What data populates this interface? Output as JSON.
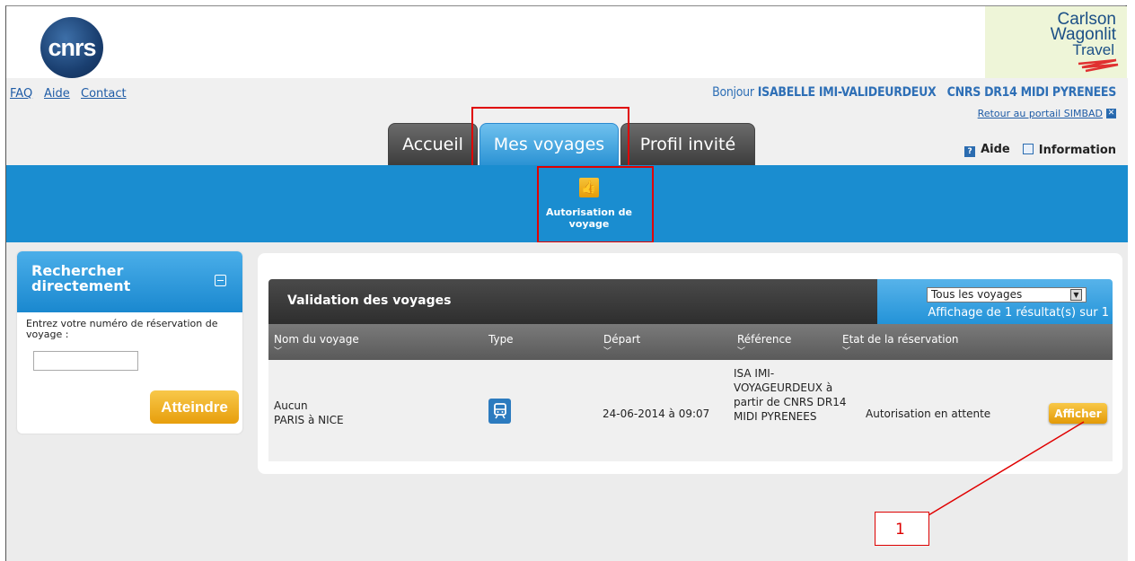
{
  "header": {
    "cnrs_logo": "cnrs",
    "partner_logo": [
      "Carlson",
      "Wagonlit",
      "Travel"
    ],
    "links": [
      "FAQ",
      "Aide",
      "Contact"
    ],
    "greeting_prefix": "Bonjour",
    "user_name": "ISABELLE IMI-VALIDEURDEUX",
    "organization": "CNRS DR14 MIDI PYRENEES",
    "return_link": "Retour au portail SIMBAD",
    "help_label": "Aide",
    "info_label": "Information"
  },
  "tabs": [
    {
      "label": "Accueil",
      "active": false
    },
    {
      "label": "Mes voyages",
      "active": true
    },
    {
      "label": "Profil invité",
      "active": false
    }
  ],
  "subnav": {
    "label": "Autorisation de voyage",
    "icon": "thumbs-up-icon"
  },
  "sidebar": {
    "title_line1": "Rechercher",
    "title_line2": "directement",
    "prompt": "Entrez votre numéro de réservation de voyage :",
    "input_value": "",
    "button_label": "Atteindre"
  },
  "validation": {
    "title": "Validation des voyages",
    "filter_selected": "Tous les voyages",
    "result_count": "Affichage de 1 résultat(s) sur 1",
    "columns": [
      "Nom du voyage",
      "Type",
      "Départ",
      "Référence",
      "Etat de la réservation"
    ],
    "rows": [
      {
        "name_line1": "Aucun",
        "name_line2": "PARIS à NICE",
        "type": "train-icon",
        "departure": "24-06-2014 à 09:07",
        "reference": "ISA IMI-VOYAGEURDEUX à partir de CNRS DR14 MIDI PYRENEES",
        "status": "Autorisation en attente",
        "action": "Afficher"
      }
    ]
  },
  "annotation": {
    "label": "1"
  },
  "colors": {
    "accent_blue": "#1a8dd0",
    "button_orange": "#f0b020",
    "highlight_red": "#e00000"
  }
}
